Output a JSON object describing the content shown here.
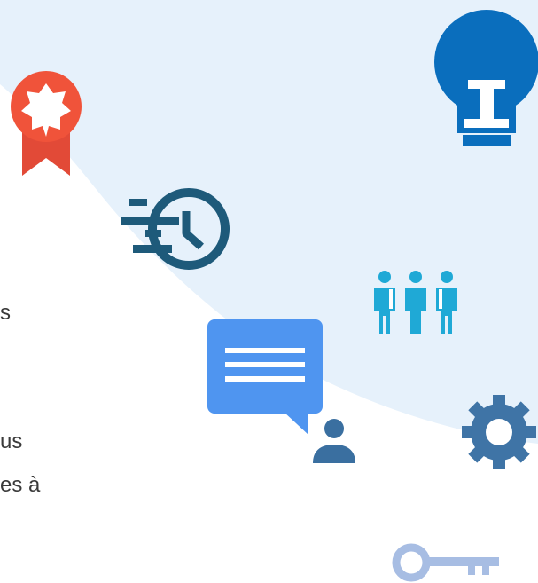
{
  "text_fragments": {
    "line_1": "s",
    "line_2": "us",
    "line_3": "es à"
  },
  "icons": {
    "badge": "award-ribbon-icon",
    "history": "history-clock-icon",
    "idea": "lightbulb-icon",
    "team": "team-people-icon",
    "chat": "chat-message-icon",
    "user": "user-icon",
    "settings": "gear-icon",
    "key": "key-icon"
  },
  "colors": {
    "background_curve": "#e6f1fb",
    "badge": "#f0533a",
    "history": "#1e5a7a",
    "idea": "#0a6ebd",
    "team": "#1fa9d6",
    "chat": "#4f95f0",
    "user": "#3a6fa0",
    "settings": "#3f74a6",
    "key": "#a7bde3"
  }
}
